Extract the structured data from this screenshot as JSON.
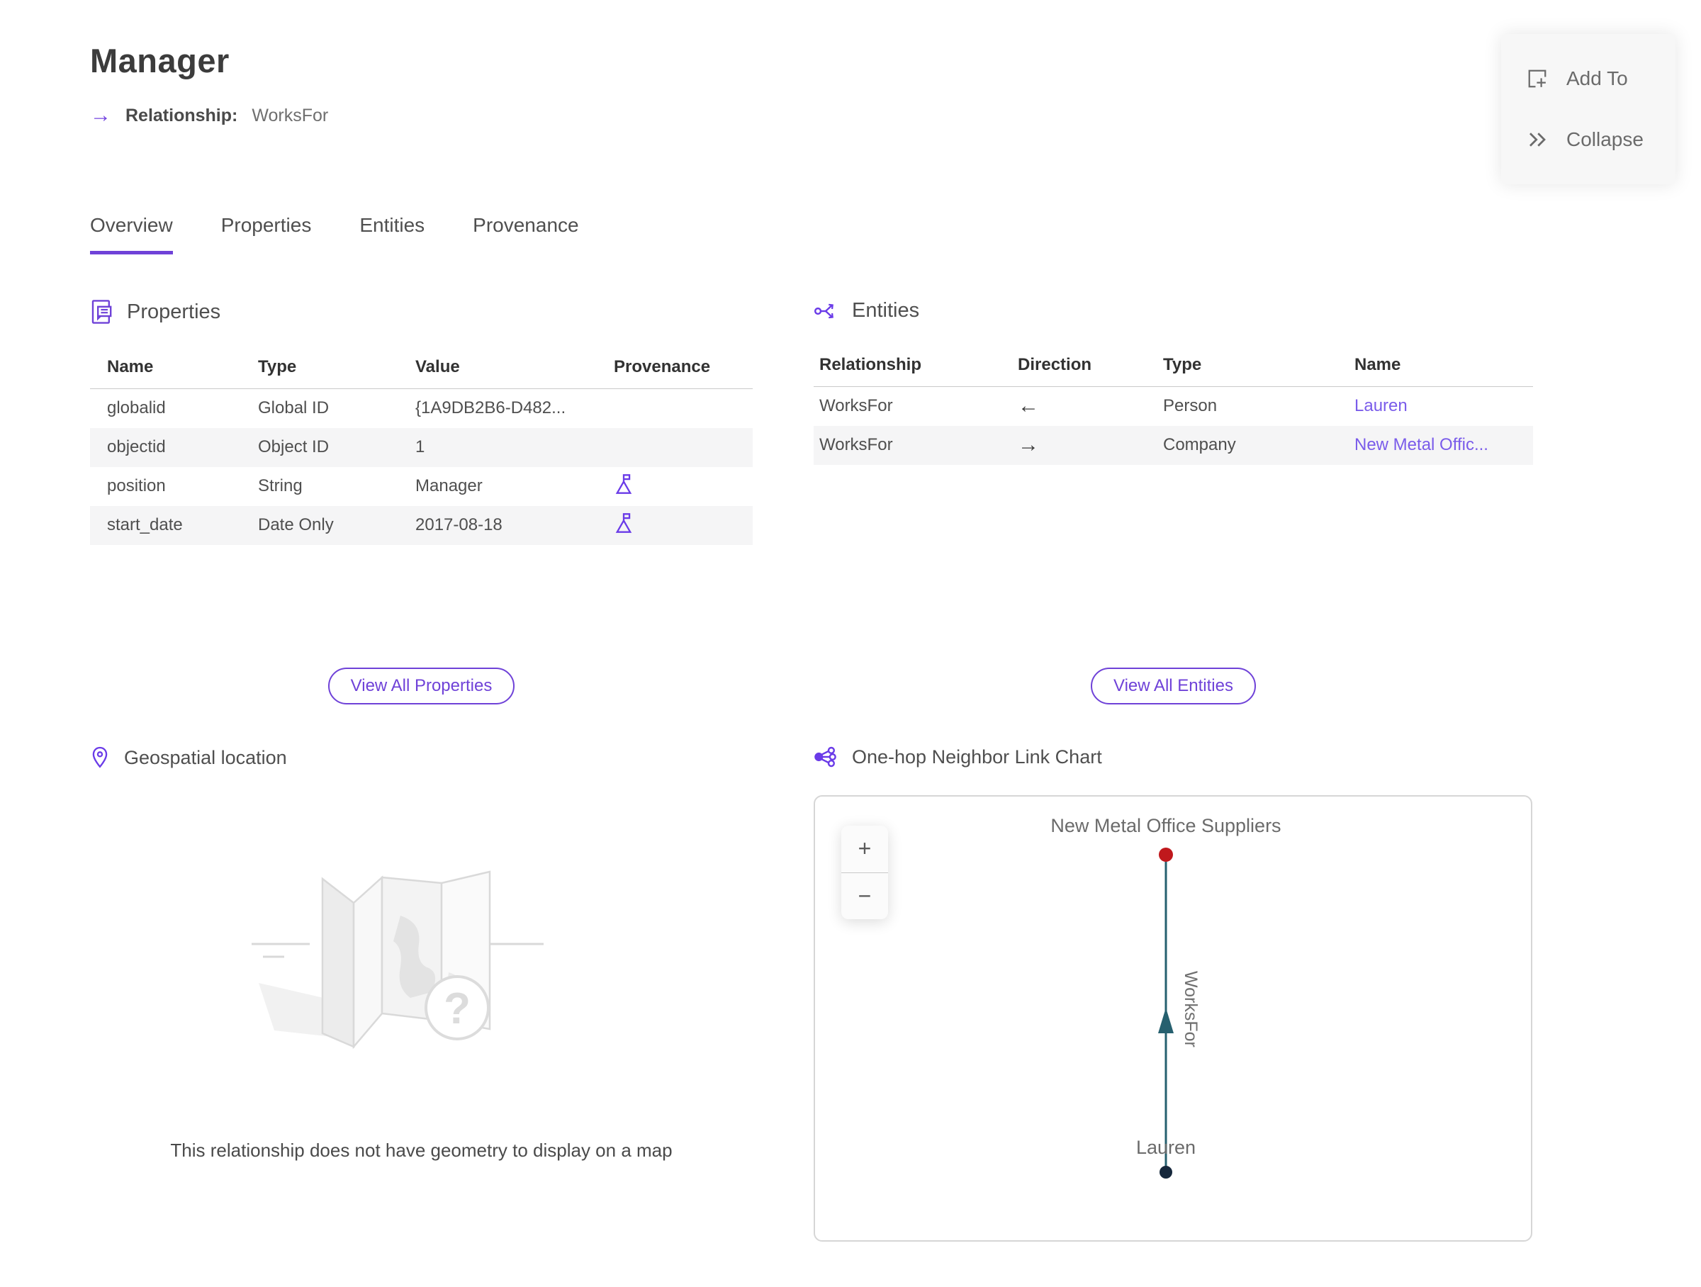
{
  "header": {
    "title": "Manager",
    "subtitle_label": "Relationship:",
    "subtitle_value": "WorksFor",
    "subtitle_arrow": "→"
  },
  "actions": {
    "add_to": "Add To",
    "collapse": "Collapse"
  },
  "tabs": [
    {
      "label": "Overview",
      "active": true
    },
    {
      "label": "Properties",
      "active": false
    },
    {
      "label": "Entities",
      "active": false
    },
    {
      "label": "Provenance",
      "active": false
    }
  ],
  "properties_section": {
    "title": "Properties",
    "columns": [
      "Name",
      "Type",
      "Value",
      "Provenance"
    ],
    "rows": [
      {
        "name": "globalid",
        "type": "Global ID",
        "value": "{1A9DB2B6-D482...",
        "provenance": false
      },
      {
        "name": "objectid",
        "type": "Object ID",
        "value": "1",
        "provenance": false
      },
      {
        "name": "position",
        "type": "String",
        "value": "Manager",
        "provenance": true
      },
      {
        "name": "start_date",
        "type": "Date Only",
        "value": "2017-08-18",
        "provenance": true
      }
    ],
    "view_all_label": "View All Properties"
  },
  "entities_section": {
    "title": "Entities",
    "columns": [
      "Relationship",
      "Direction",
      "Type",
      "Name"
    ],
    "rows": [
      {
        "relationship": "WorksFor",
        "direction": "←",
        "type": "Person",
        "name": "Lauren"
      },
      {
        "relationship": "WorksFor",
        "direction": "→",
        "type": "Company",
        "name": "New Metal Offic..."
      }
    ],
    "view_all_label": "View All Entities"
  },
  "geospatial_section": {
    "title": "Geospatial location",
    "empty_message": "This relationship does not have geometry to display on a map"
  },
  "link_chart_section": {
    "title": "One-hop Neighbor Link Chart",
    "zoom_in": "+",
    "zoom_out": "−",
    "nodes": [
      {
        "label": "New Metal Office Suppliers",
        "color": "#c0181c"
      },
      {
        "label": "Lauren",
        "color": "#16283c"
      }
    ],
    "edge": {
      "label": "WorksFor",
      "color": "#26606f"
    }
  },
  "colors": {
    "accent_purple": "#6f42d8",
    "link_purple": "#7a5cea",
    "text_dark": "#3c3c3c",
    "text_gray": "#4f4f4f",
    "text_muted": "#6f6f6f",
    "row_alt": "#f5f5f6",
    "node_red": "#c0181c",
    "node_dark": "#16283c",
    "edge_teal": "#26606f"
  }
}
